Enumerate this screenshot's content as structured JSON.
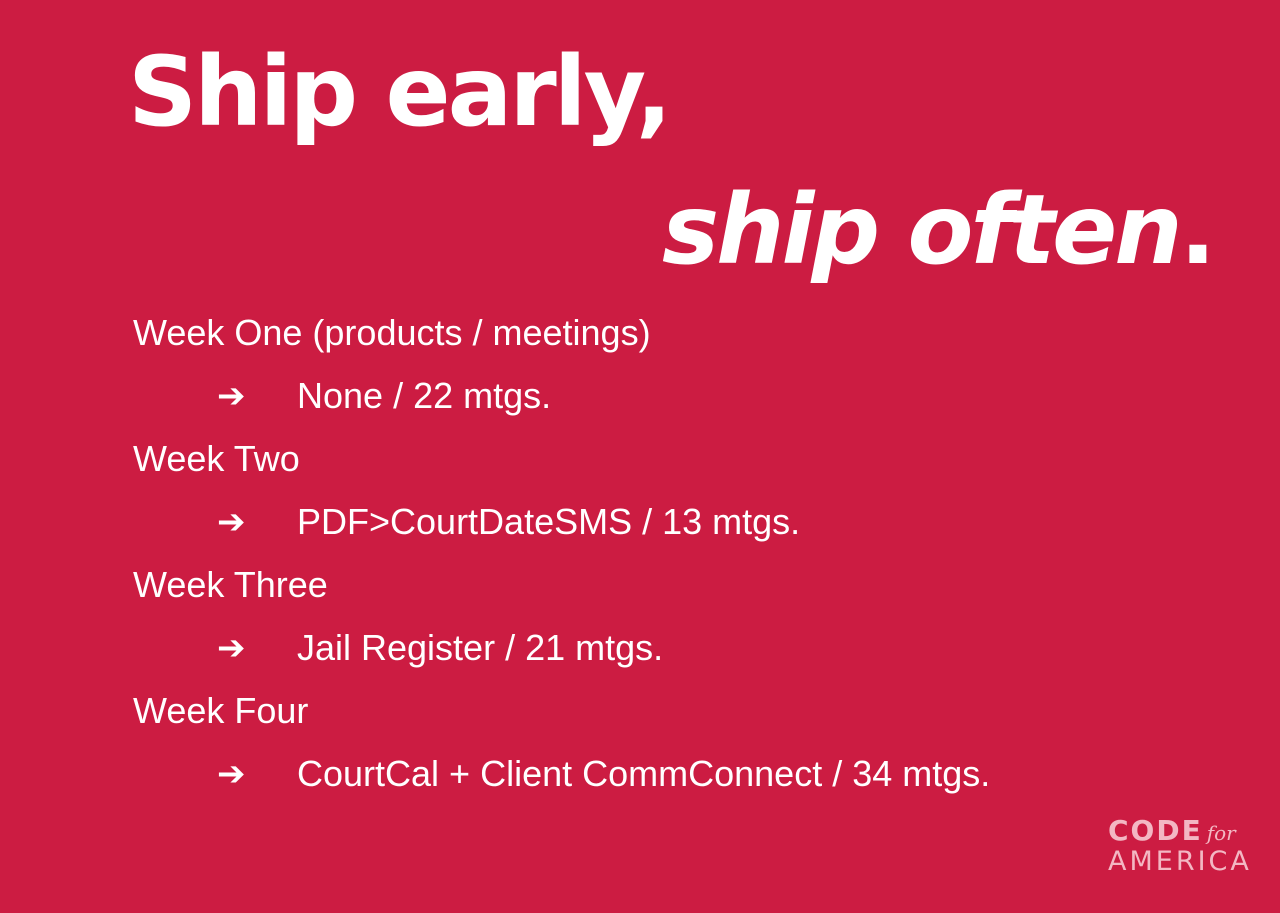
{
  "title": {
    "line1": "Ship early,",
    "line2": "ship often",
    "line2_end": "."
  },
  "weeks": [
    {
      "label": "Week One (products / meetings)",
      "item": "None / 22 mtgs."
    },
    {
      "label": "Week Two",
      "item": "PDF>CourtDateSMS / 13 mtgs."
    },
    {
      "label": "Week Three",
      "item": "Jail Register / 21 mtgs."
    },
    {
      "label": "Week Four",
      "item": "CourtCal + Client CommConnect / 34 mtgs."
    }
  ],
  "bullet_symbol": "➔",
  "logo": {
    "code": "CODE",
    "for": "for",
    "america": "AMERICA"
  },
  "colors": {
    "background": "#cc1c42",
    "text": "#ffffff",
    "logo": "#f3b7c3"
  }
}
